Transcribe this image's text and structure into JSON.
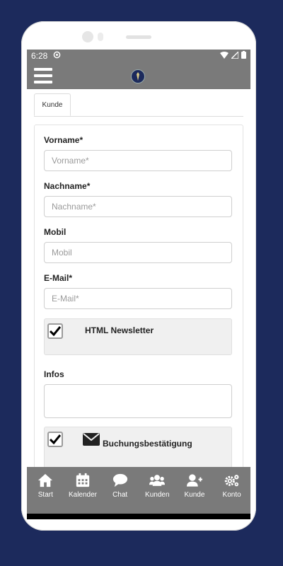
{
  "status": {
    "time": "6:28"
  },
  "tabs": [
    {
      "label": "Kunde"
    }
  ],
  "form": {
    "vorname": {
      "label": "Vorname*",
      "placeholder": "Vorname*",
      "value": ""
    },
    "nachname": {
      "label": "Nachname*",
      "placeholder": "Nachname*",
      "value": ""
    },
    "mobil": {
      "label": "Mobil",
      "placeholder": "Mobil",
      "value": ""
    },
    "email": {
      "label": "E-Mail*",
      "placeholder": "E-Mail*",
      "value": ""
    },
    "newsletter": {
      "label": "HTML Newsletter",
      "checked": true
    },
    "infos": {
      "label": "Infos",
      "value": ""
    },
    "buchung": {
      "label": "Buchungsbestätigung",
      "checked": true
    }
  },
  "bottom_nav": [
    {
      "label": "Start",
      "icon": "home-icon"
    },
    {
      "label": "Kalender",
      "icon": "calendar-icon"
    },
    {
      "label": "Chat",
      "icon": "chat-icon"
    },
    {
      "label": "Kunden",
      "icon": "users-icon"
    },
    {
      "label": "Kunde",
      "icon": "user-plus-icon"
    },
    {
      "label": "Konto",
      "icon": "gears-icon"
    }
  ],
  "colors": {
    "background": "#1c2a5c",
    "appbar": "#7a7a7a",
    "panel": "#f0f0f0"
  }
}
